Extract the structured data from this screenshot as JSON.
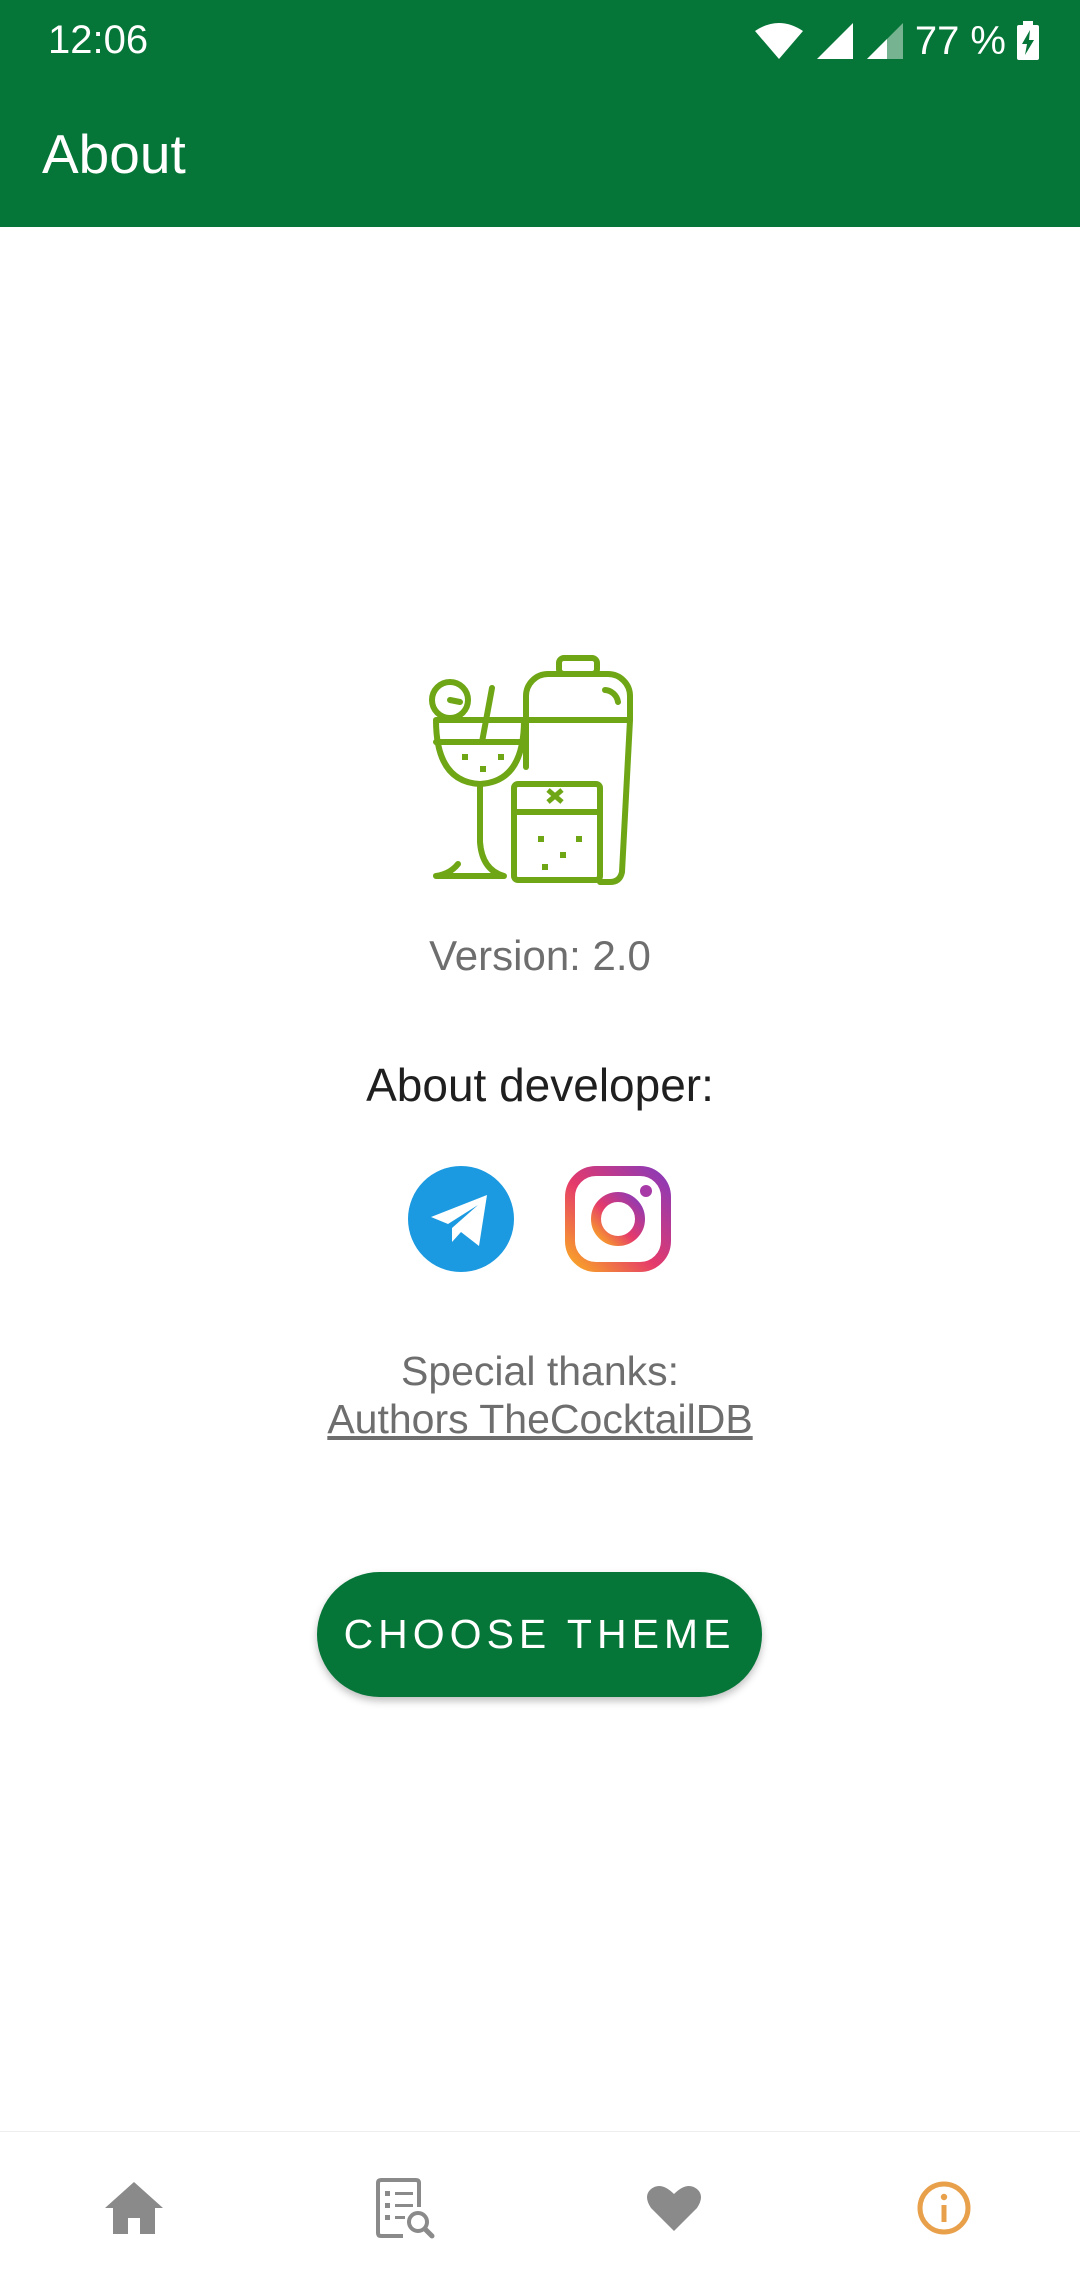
{
  "status_bar": {
    "time": "12:06",
    "battery": "77 %"
  },
  "app_bar": {
    "title": "About"
  },
  "content": {
    "version": "Version: 2.0",
    "about_developer": "About developer:",
    "special_thanks": "Special thanks:",
    "thanks_link": "Authors TheCocktailDB",
    "theme_button": "CHOOSE THEME"
  },
  "icons": {
    "logo": "cocktail-logo-icon",
    "telegram": "telegram-icon",
    "instagram": "instagram-icon",
    "nav": [
      "home-icon",
      "search-list-icon",
      "heart-icon",
      "info-icon"
    ]
  },
  "colors": {
    "primary": "#057638",
    "logo": "#6fa615",
    "accent": "#e8a04a",
    "nav_inactive": "#8a8a8a",
    "telegram": "#1b9ae1"
  }
}
